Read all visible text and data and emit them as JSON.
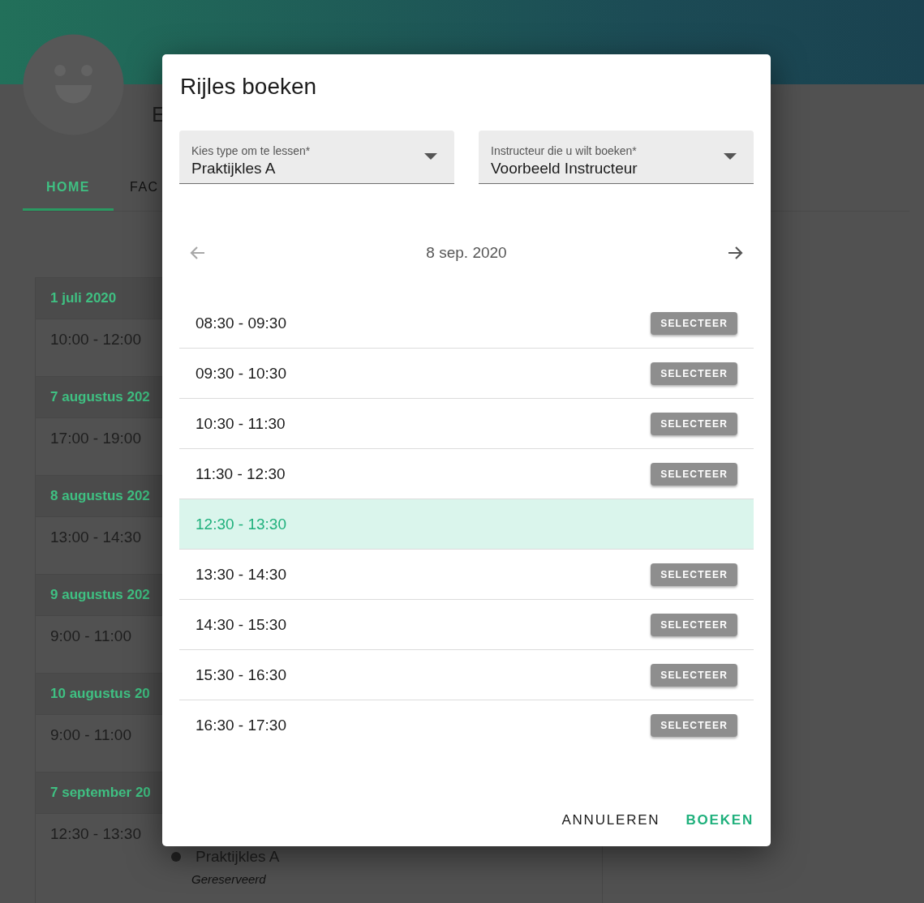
{
  "profile": {
    "name": "E"
  },
  "tabs": [
    {
      "label": "HOME",
      "selected": true
    },
    {
      "label": "FAC",
      "selected": false
    }
  ],
  "agenda": [
    {
      "date": "1 juli 2020",
      "time": "10:00 - 12:00"
    },
    {
      "date": "7 augustus 202",
      "time": "17:00 - 19:00"
    },
    {
      "date": "8 augustus 202",
      "time": "13:00 - 14:30"
    },
    {
      "date": "9 augustus 202",
      "time": "9:00 - 11:00"
    },
    {
      "date": "10 augustus 20",
      "time": "9:00 - 11:00"
    },
    {
      "date": "7 september 20",
      "time": "12:30 - 13:30",
      "lesson": "Praktijkles A",
      "status": "Gereserveerd"
    }
  ],
  "dialog": {
    "title": "Rijles boeken",
    "fields": [
      {
        "label": "Kies type om te lessen*",
        "value": "Praktijkles A"
      },
      {
        "label": "Instructeur die u wilt boeken*",
        "value": "Voorbeeld Instructeur"
      }
    ],
    "date_nav": {
      "date": "8 sep. 2020",
      "prev_disabled": true,
      "next_disabled": false
    },
    "slots": [
      {
        "time": "08:30 - 09:30",
        "selected": false,
        "button": "SELECTEER"
      },
      {
        "time": "09:30 - 10:30",
        "selected": false,
        "button": "SELECTEER"
      },
      {
        "time": "10:30 - 11:30",
        "selected": false,
        "button": "SELECTEER"
      },
      {
        "time": "11:30 - 12:30",
        "selected": false,
        "button": "SELECTEER"
      },
      {
        "time": "12:30 - 13:30",
        "selected": true
      },
      {
        "time": "13:30 - 14:30",
        "selected": false,
        "button": "SELECTEER"
      },
      {
        "time": "14:30 - 15:30",
        "selected": false,
        "button": "SELECTEER"
      },
      {
        "time": "15:30 - 16:30",
        "selected": false,
        "button": "SELECTEER"
      },
      {
        "time": "16:30 - 17:30",
        "selected": false,
        "button": "SELECTEER"
      }
    ],
    "actions": [
      {
        "label": "ANNULEREN",
        "kind": "secondary"
      },
      {
        "label": "BOEKEN",
        "kind": "primary"
      }
    ]
  }
}
